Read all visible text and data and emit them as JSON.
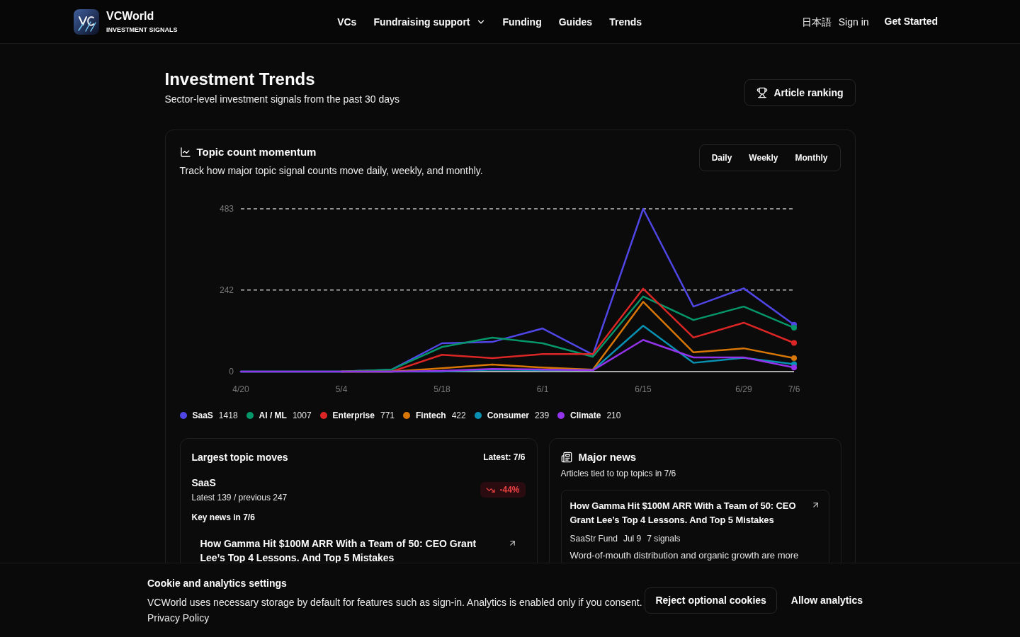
{
  "header": {
    "brand": {
      "name": "VCWorld",
      "tagline": "INVESTMENT SIGNALS"
    },
    "nav": [
      {
        "label": "VCs",
        "kind": "link"
      },
      {
        "label": "Fundraising support",
        "kind": "dropdown"
      },
      {
        "label": "Funding",
        "kind": "link"
      },
      {
        "label": "Guides",
        "kind": "link"
      },
      {
        "label": "Trends",
        "kind": "link"
      }
    ],
    "actions": [
      {
        "label": "日本語",
        "kind": "link"
      },
      {
        "label": "Sign in",
        "kind": "link"
      },
      {
        "label": "Get Started",
        "kind": "primary"
      }
    ]
  },
  "page": {
    "title": "Investment Trends",
    "subtitle": "Sector-level investment signals from the past 30 days",
    "ranking_button": "Article ranking"
  },
  "momentum": {
    "title": "Topic count momentum",
    "description": "Track how major topic signal counts move daily, weekly, and monthly.",
    "periods": [
      "Daily",
      "Weekly",
      "Monthly"
    ],
    "chart_data": {
      "type": "line",
      "categories": [
        "4/20",
        null,
        "5/4",
        null,
        "5/18",
        null,
        "6/1",
        null,
        "6/15",
        null,
        "6/29",
        "7/6"
      ],
      "ylim": [
        0,
        483
      ],
      "yticks": [
        0,
        242,
        483
      ],
      "series": [
        {
          "name": "SaaS",
          "color": "#4f46e5",
          "values": [
            null,
            null,
            0,
            6,
            84,
            88,
            128,
            50,
            483,
            193,
            247,
            139
          ]
        },
        {
          "name": "AI / ML",
          "color": "#059669",
          "values": [
            0,
            0,
            0,
            6,
            73,
            101,
            84,
            44,
            223,
            153,
            193,
            130
          ]
        },
        {
          "name": "Enterprise",
          "color": "#dc2626",
          "values": [
            null,
            null,
            0,
            0,
            50,
            40,
            52,
            52,
            246,
            101,
            145,
            85
          ]
        },
        {
          "name": "Fintech",
          "color": "#d97706",
          "values": [
            null,
            null,
            0,
            0,
            10,
            21,
            12,
            6,
            207,
            57,
            69,
            40
          ]
        },
        {
          "name": "Consumer",
          "color": "#0891b2",
          "values": [
            0,
            0,
            0,
            0,
            0,
            6,
            4,
            4,
            136,
            26,
            41,
            22
          ]
        },
        {
          "name": "Climate",
          "color": "#9333ea",
          "values": [
            0,
            0,
            0,
            0,
            2,
            8,
            6,
            4,
            94,
            42,
            42,
            12
          ]
        }
      ]
    },
    "legend_counts": [
      "1418",
      "1007",
      "771",
      "422",
      "239",
      "210"
    ]
  },
  "largest_moves": {
    "title": "Largest topic moves",
    "latest": "Latest: 7/6",
    "topics": [
      {
        "name": "SaaS",
        "detail": "Latest 139 / previous 247",
        "change": "-44%",
        "kind": "down"
      }
    ],
    "key_news_heading": "Key news in 7/6",
    "key_news": [
      {
        "title": "How Gamma Hit $100M ARR With a Team of 50: CEO Grant Lee’s Top 4 Lessons. And Top 5 Mistakes"
      }
    ]
  },
  "major_news": {
    "title": "Major news",
    "subtitle": "Articles tied to top topics in 7/6",
    "articles": [
      {
        "title": "How Gamma Hit $100M ARR With a Team of 50: CEO Grant Lee’s Top 4 Lessons. And Top 5 Mistakes",
        "source": "SaaStr Fund",
        "date": "Jul 9",
        "signals": "7 signals",
        "summary": "Word-of-mouth distribution and organic growth are more"
      }
    ]
  },
  "cookie_banner": {
    "title": "Cookie and analytics settings",
    "body": "VCWorld uses necessary storage by default for features such as sign-in. Analytics is enabled only if you consent.",
    "link": "Privacy Policy",
    "buttons": [
      {
        "label": "Reject optional cookies",
        "kind": "outline"
      },
      {
        "label": "Allow analytics",
        "kind": "text"
      }
    ]
  }
}
